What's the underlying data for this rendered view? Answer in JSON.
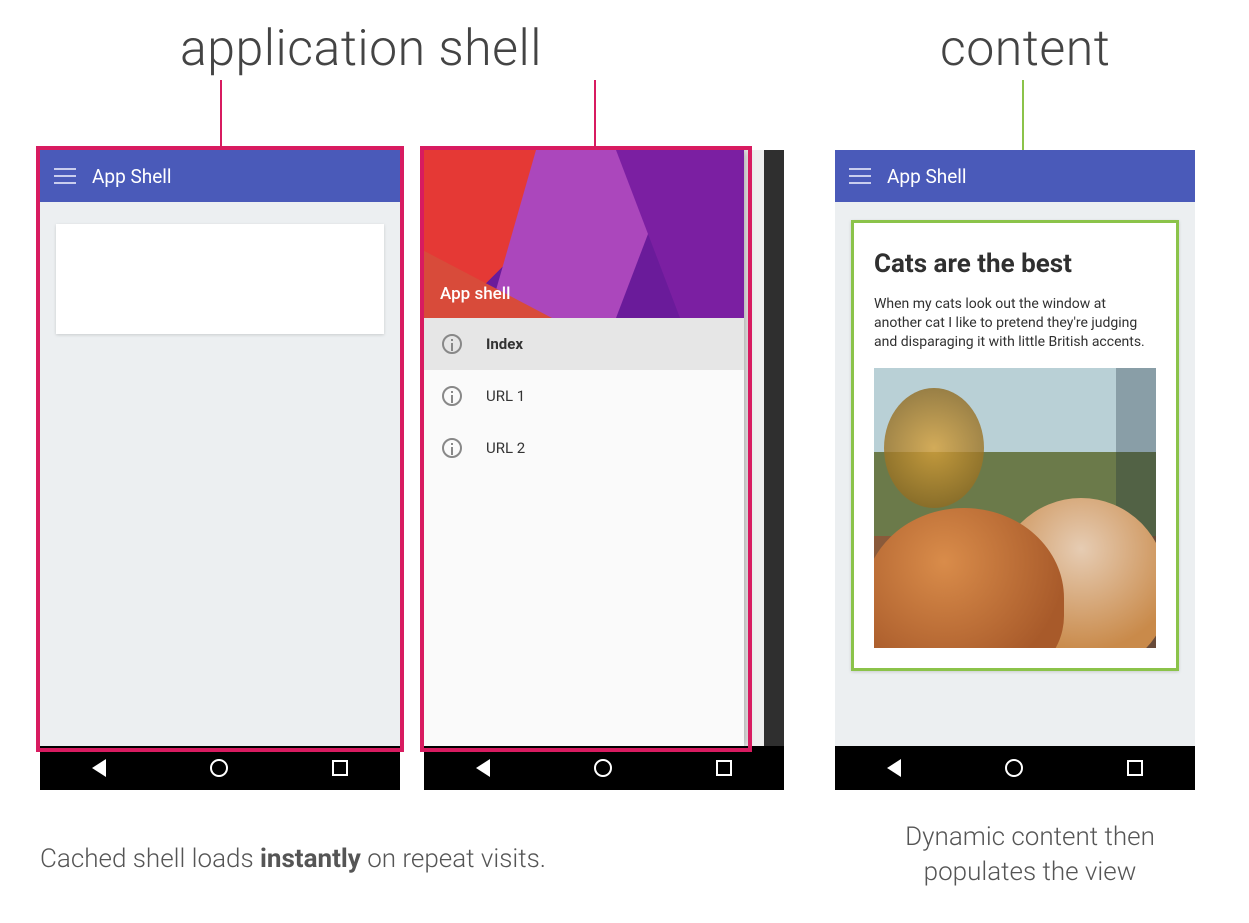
{
  "headings": {
    "left": "application shell",
    "right": "content"
  },
  "appbar": {
    "title": "App Shell"
  },
  "drawer": {
    "header_title": "App shell",
    "items": [
      {
        "label": "Index",
        "selected": true
      },
      {
        "label": "URL 1",
        "selected": false
      },
      {
        "label": "URL 2",
        "selected": false
      }
    ]
  },
  "content": {
    "title": "Cats are the best",
    "body": "When my cats look out the window at another cat I like to pretend they're judging and disparaging it with little British accents."
  },
  "captions": {
    "left_pre": "Cached shell loads ",
    "left_bold": "instantly",
    "left_post": " on repeat visits.",
    "right": "Dynamic content then populates the view"
  }
}
